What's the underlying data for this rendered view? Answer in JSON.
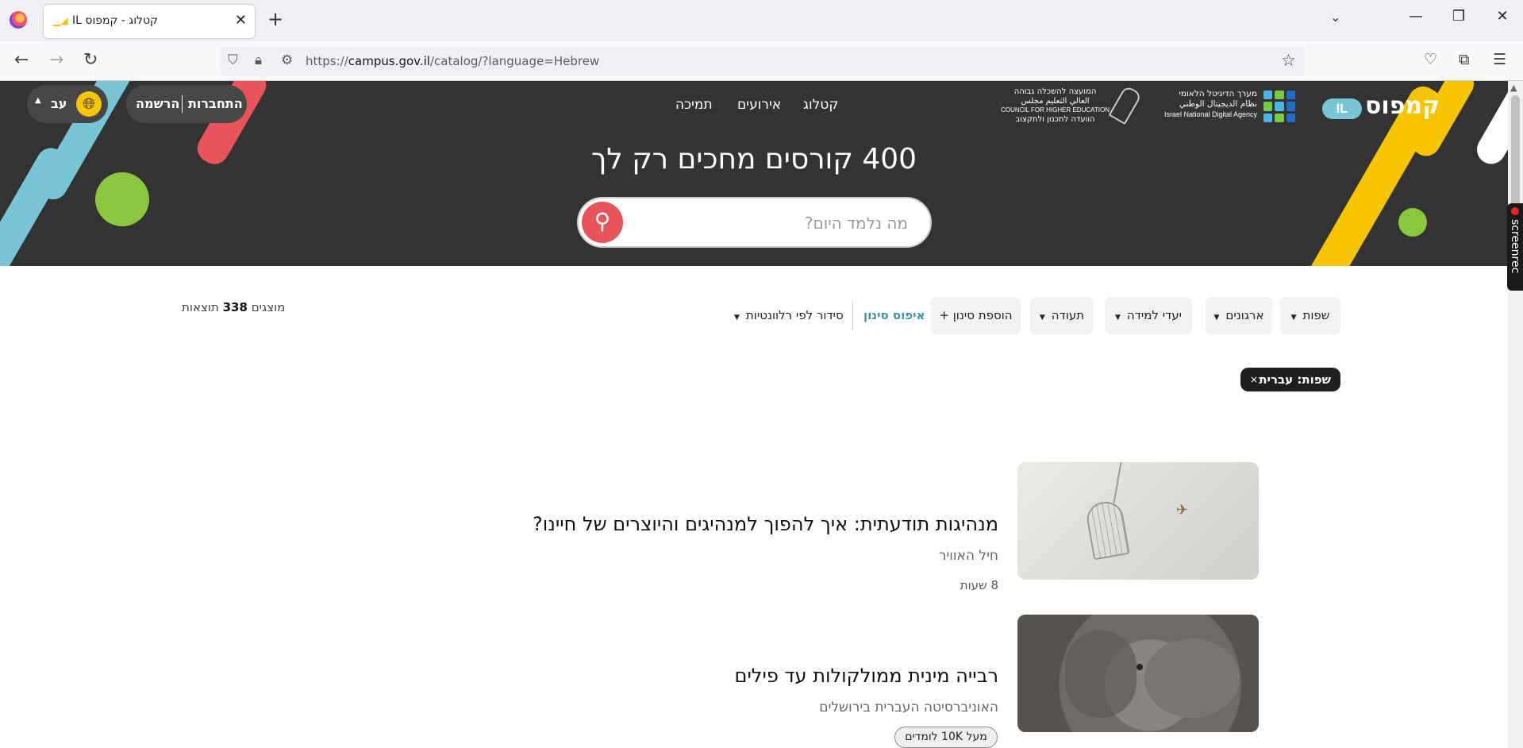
{
  "browser": {
    "tab_title": "קטלוג - קמפוס IL",
    "url_host": "campus.gov.il",
    "url_prefix": "https://",
    "url_path": "/catalog/?language=Hebrew",
    "icons": [
      "firefox-icon",
      "close-icon",
      "plus-icon",
      "chevron-down-icon",
      "minimize-icon",
      "restore-icon",
      "back-icon",
      "forward-icon",
      "reload-icon",
      "shield-icon",
      "lock-icon",
      "permissions-icon",
      "star-icon",
      "pocket-icon",
      "extensions-icon",
      "menu-icon"
    ]
  },
  "header": {
    "brand_name": "קמפוס",
    "brand_il": "IL",
    "digital_agency": {
      "line1": "מערך הדיגיטל הלאומי",
      "line2": "نظام الديجيتال الوطني",
      "line3": "Israel National Digital Agency"
    },
    "che": {
      "line1": "המועצה להשכלה גבוהה",
      "line2": "العالي التعليم مجلس",
      "line3": "COUNCIL FOR HIGHER EDUCATION",
      "line4": "הוועדה לתכנון ולתקצוב"
    },
    "nav": {
      "catalog": "קטלוג",
      "events": "אירועים",
      "support": "תמיכה"
    },
    "login": "התחברות",
    "register": "הרשמה",
    "language": "עב",
    "hero_title": "400 קורסים מחכים רק לך",
    "search_placeholder": "מה נלמד היום?",
    "colors": {
      "dark": "#333333",
      "yellow": "#f7c400",
      "red": "#e8545a",
      "teal": "#78c5d6",
      "green": "#8cc63f"
    }
  },
  "filters": {
    "languages": "שפות",
    "organizations": "ארגונים",
    "learning_goals": "יעדי למידה",
    "certificate": "תעודה",
    "add_filter": "הוספת סינון +",
    "reset": "איפוס סינון",
    "sort": "סידור לפי רלוונטיות",
    "results_prefix": "מוצגים",
    "results_count": "338",
    "results_suffix": "תוצאות",
    "active_chip": "שפות: עברית",
    "chip_close": "×"
  },
  "courses": [
    {
      "title": "מנהיגות תודעתית: איך להפוך למנהיגים והיוצרים של חיינו?",
      "org": "חיל האוויר",
      "meta": "8 שעות"
    },
    {
      "title": "רבייה מינית ממולקולות עד פילים",
      "org": "האוניברסיטה העברית בירושלים",
      "badge": "מעל 10K לומדים"
    }
  ],
  "screenrec_label": "screenrec"
}
